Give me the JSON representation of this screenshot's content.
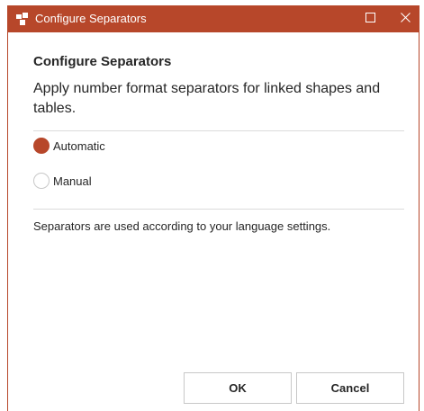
{
  "window": {
    "title": "Configure Separators",
    "accent_color": "#b7472a",
    "icons": [
      "app-icon",
      "maximize-icon",
      "close-icon"
    ]
  },
  "content": {
    "heading": "Configure Separators",
    "description": "Apply number format separators for linked shapes and tables.",
    "options": [
      {
        "label": "Automatic",
        "checked": true
      },
      {
        "label": "Manual",
        "checked": false
      }
    ],
    "info": "Separators are used according to your language settings."
  },
  "buttons": {
    "ok_label": "OK",
    "cancel_label": "Cancel"
  }
}
